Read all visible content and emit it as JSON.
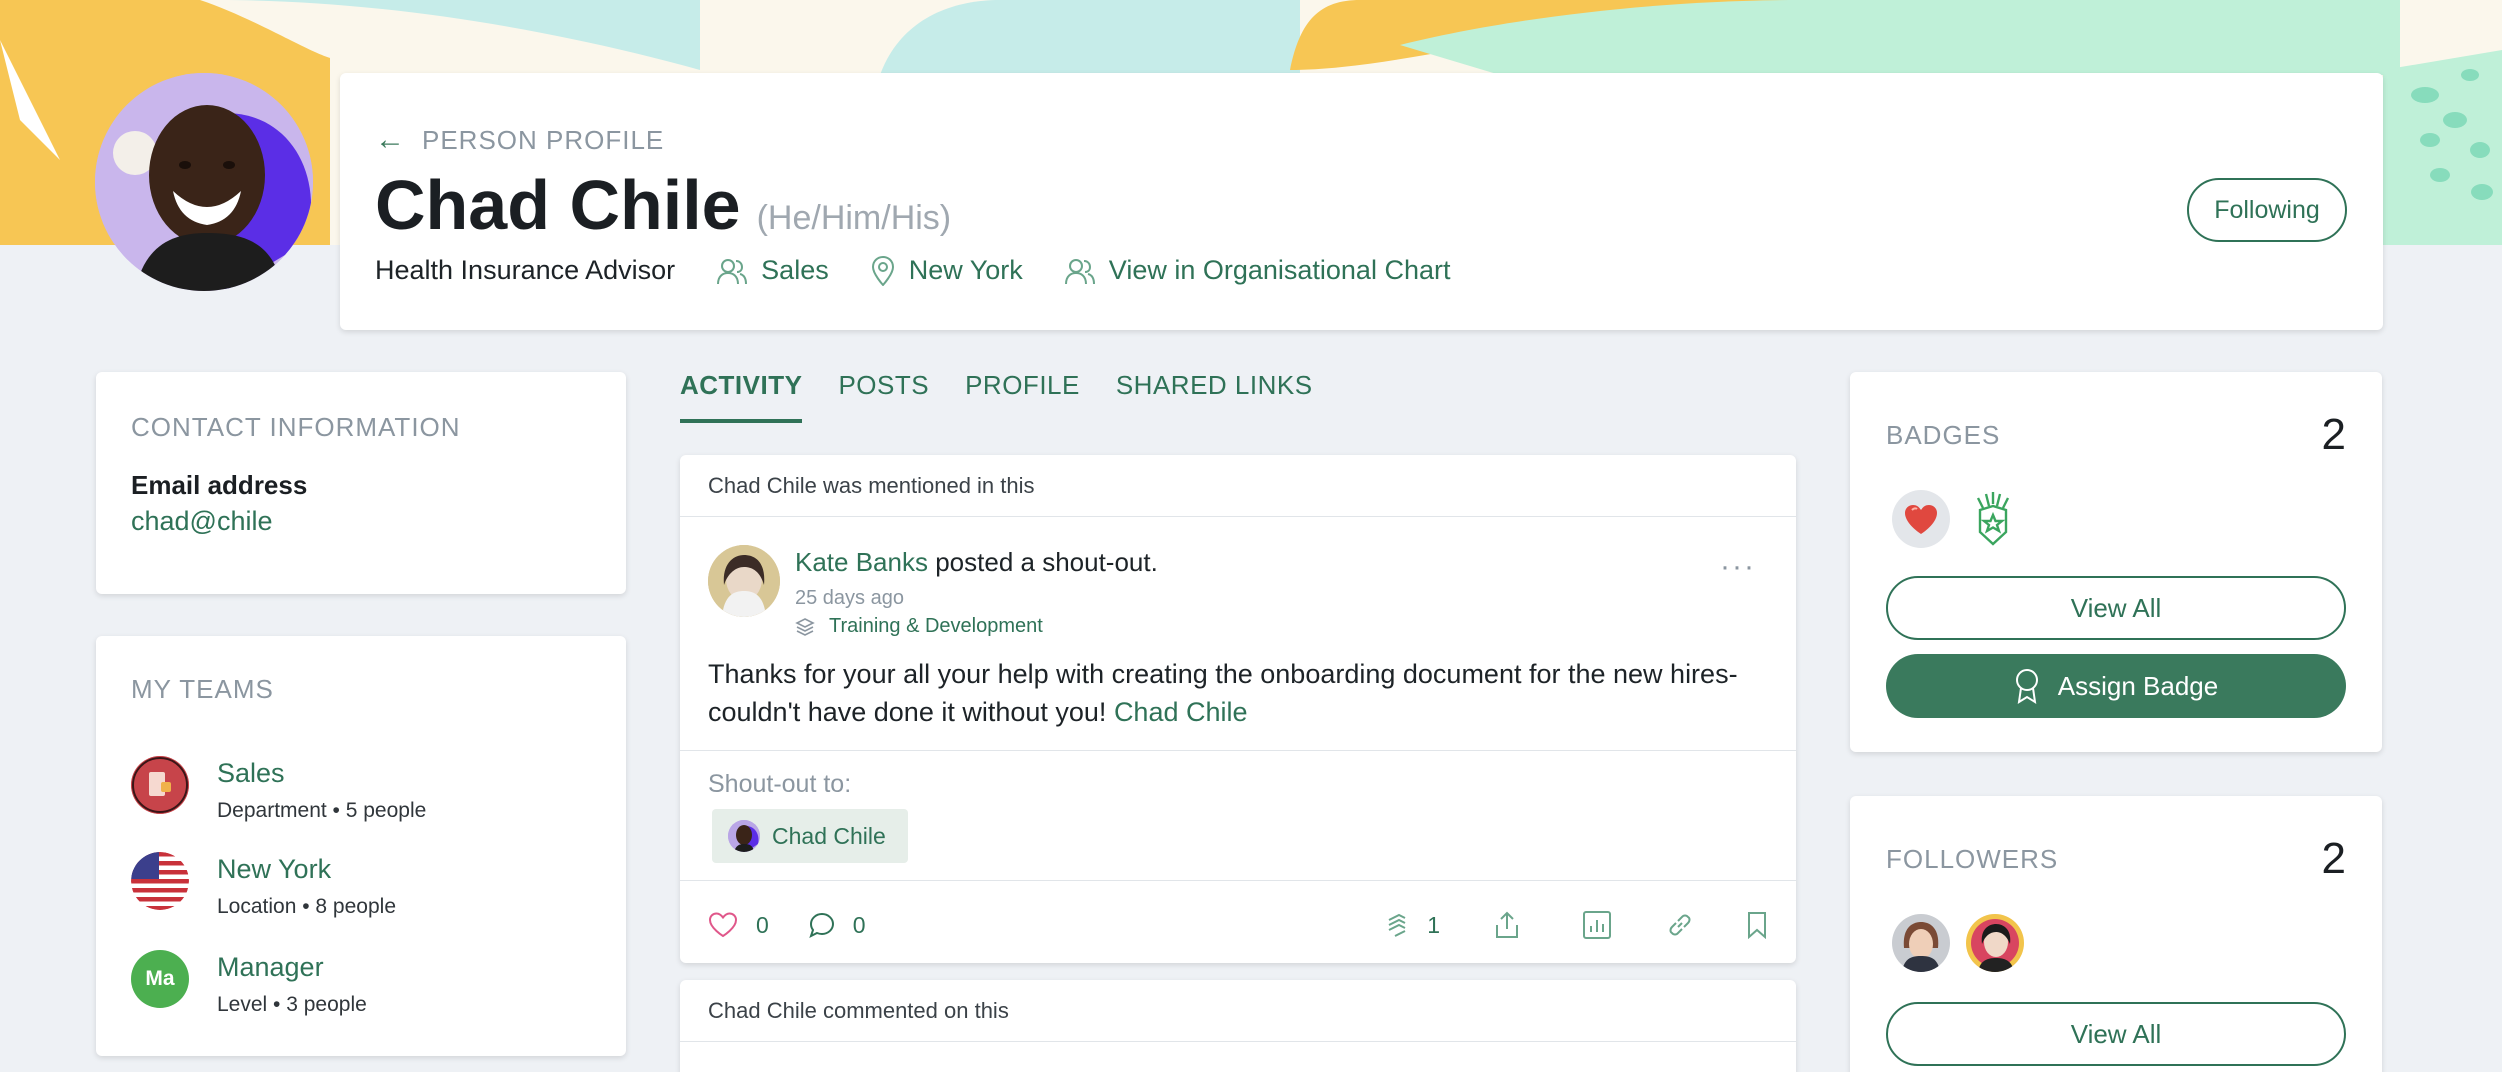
{
  "header": {
    "breadcrumb": "PERSON PROFILE",
    "name": "Chad Chile",
    "pronouns": "(He/Him/His)",
    "job_title": "Health Insurance Advisor",
    "department": "Sales",
    "location": "New York",
    "org_chart_link": "View in Organisational Chart",
    "follow_label": "Following"
  },
  "contact": {
    "title": "CONTACT INFORMATION",
    "email_label": "Email address",
    "email_value": "chad@chile"
  },
  "teams": {
    "title": "MY TEAMS",
    "items": [
      {
        "name": "Sales",
        "detail": "Department • 5 people"
      },
      {
        "name": "New York",
        "detail": "Location • 8 people"
      },
      {
        "name": "Manager",
        "detail": "Level • 3 people",
        "initials": "Ma"
      }
    ]
  },
  "tabs": [
    "ACTIVITY",
    "POSTS",
    "PROFILE",
    "SHARED LINKS"
  ],
  "post": {
    "context": "Chad Chile was mentioned in this",
    "author": "Kate Banks",
    "action": "posted a shout-out.",
    "time": "25 days ago",
    "group": "Training & Development",
    "more": "···",
    "body": "Thanks for your all your help with creating the onboarding document for the new hires- couldn't have done it without you!",
    "mention": "Chad Chile",
    "shout_label": "Shout-out to:",
    "shout_name": "Chad Chile",
    "likes": "0",
    "comments": "0",
    "shares": "1"
  },
  "post2": {
    "context": "Chad Chile commented on this"
  },
  "badges": {
    "title": "BADGES",
    "count": "2",
    "view_all": "View All",
    "assign": "Assign Badge",
    "icons": [
      "heart-badge-icon",
      "star-award-badge-icon"
    ]
  },
  "followers": {
    "title": "FOLLOWERS",
    "count": "2",
    "view_all": "View All"
  },
  "colors": {
    "accent": "#2f7257",
    "button_fill": "#3a7a5d",
    "background": "#eef1f5",
    "banner_yellow": "#f7c654",
    "banner_teal": "#c6ece9",
    "banner_mint": "#bff0d8"
  }
}
